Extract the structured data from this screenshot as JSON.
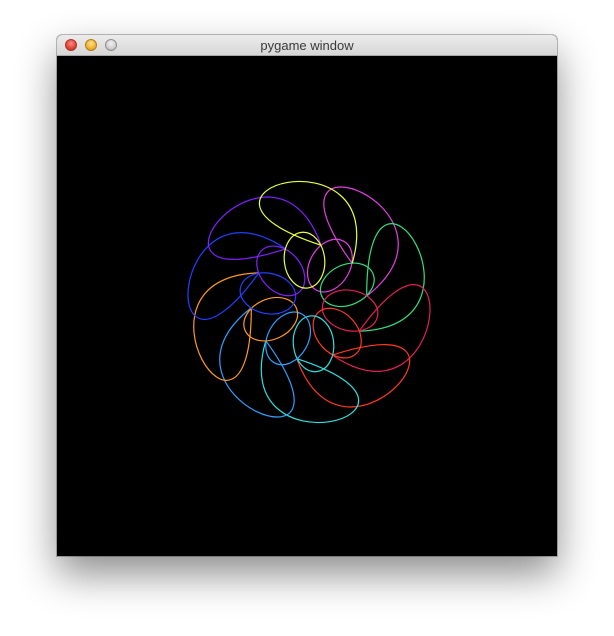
{
  "window": {
    "title": "pygame window",
    "buttons": [
      "close",
      "minimize",
      "zoom"
    ],
    "canvas_background": "#000000"
  },
  "curves": [
    {
      "name": "magenta-loop",
      "color": "#e040e0"
    },
    {
      "name": "green-loop",
      "color": "#30e080"
    },
    {
      "name": "crimson-loop",
      "color": "#e0205a"
    },
    {
      "name": "red-loop",
      "color": "#ff3a20"
    },
    {
      "name": "cyan-loop",
      "color": "#30e0e0"
    },
    {
      "name": "sky-loop",
      "color": "#30a0ff"
    },
    {
      "name": "orange-loop",
      "color": "#ff9a20"
    },
    {
      "name": "blue-loop",
      "color": "#2040ff"
    },
    {
      "name": "violet-loop",
      "color": "#8020ff"
    },
    {
      "name": "yellow-loop",
      "color": "#e8ff40"
    }
  ]
}
